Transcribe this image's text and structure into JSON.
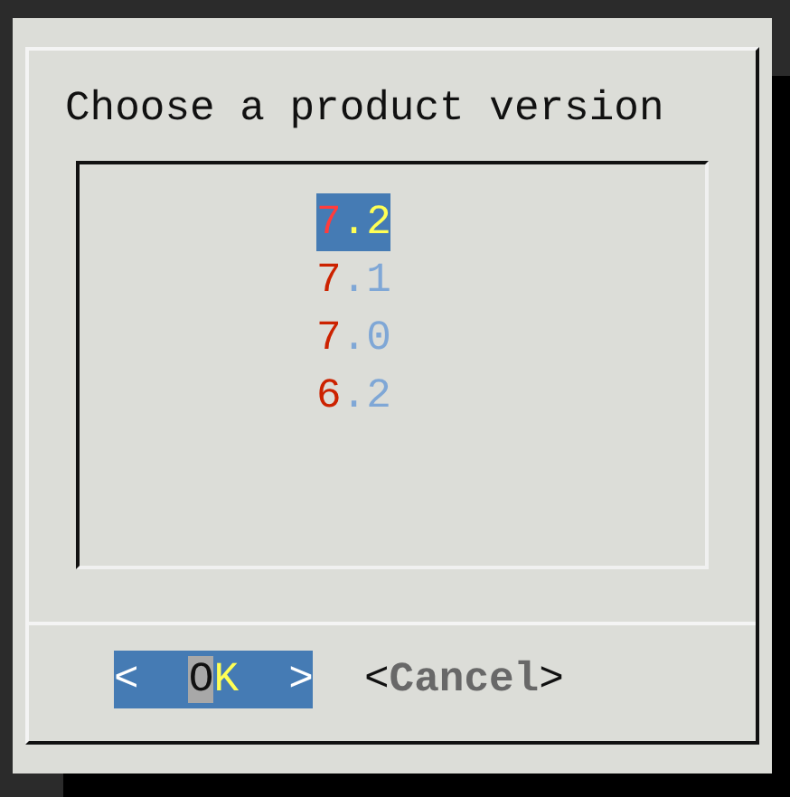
{
  "dialog": {
    "title": "Choose a product version",
    "versions": [
      {
        "hotkey": "7",
        "rest": ".2",
        "selected": true
      },
      {
        "hotkey": "7",
        "rest": ".1",
        "selected": false
      },
      {
        "hotkey": "7",
        "rest": ".0",
        "selected": false
      },
      {
        "hotkey": "6",
        "rest": ".2",
        "selected": false
      }
    ],
    "buttons": [
      {
        "open": "<",
        "label": "OK",
        "close": ">",
        "selected": true
      },
      {
        "open": "<",
        "label": "Cancel",
        "close": ">",
        "selected": false
      }
    ]
  }
}
